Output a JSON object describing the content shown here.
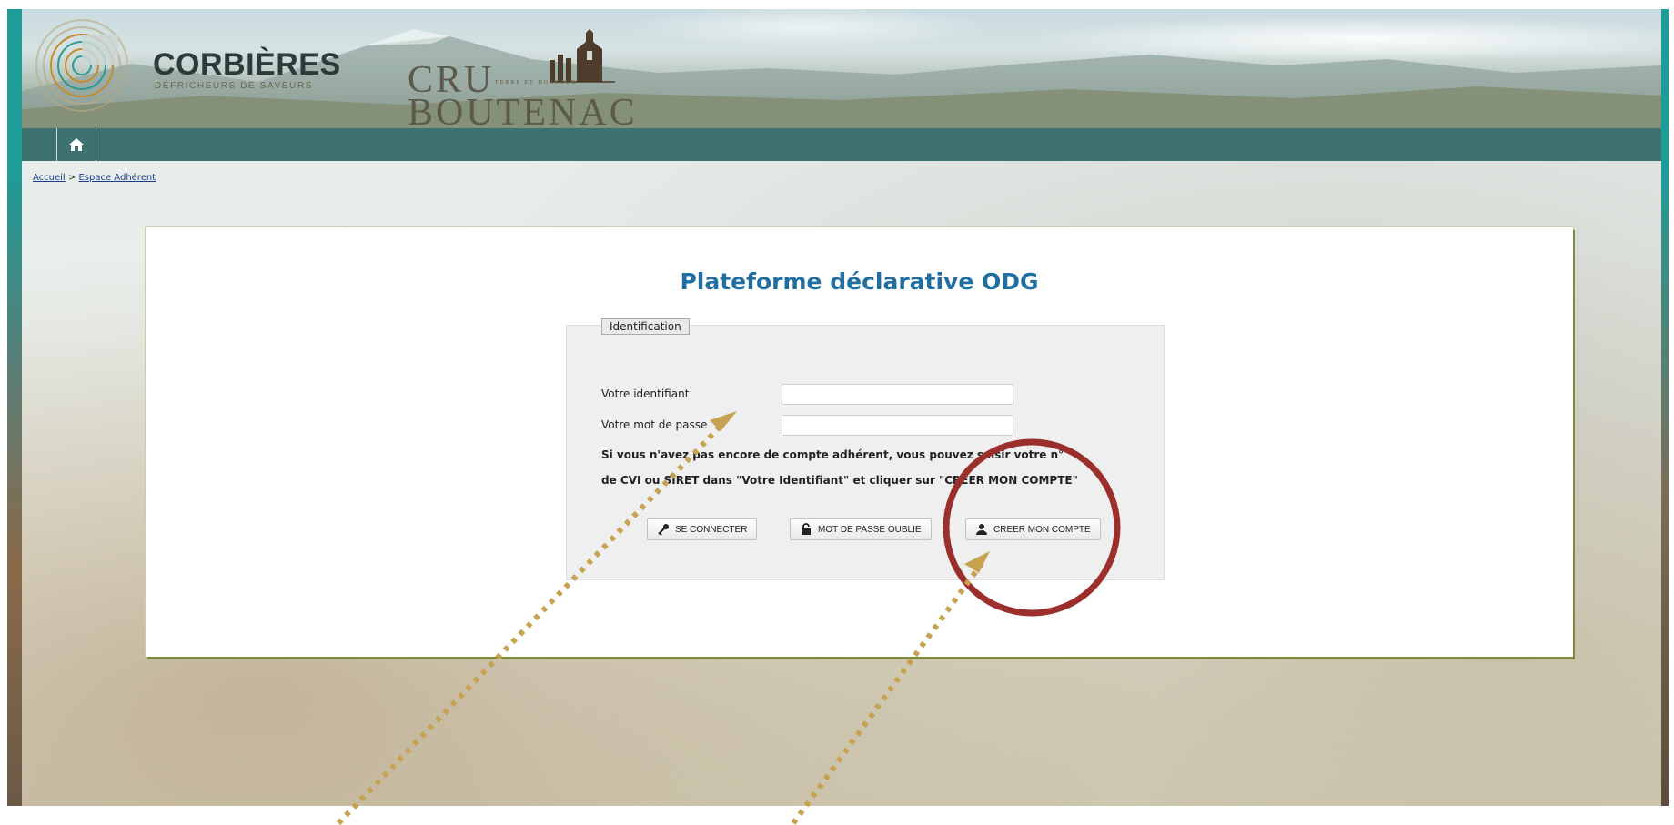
{
  "banner": {
    "brand_name": "CORBIÈRES",
    "brand_tagline": "DÉFRICHEURS DE SAVEURS",
    "cru": "CRU",
    "cru_tagline": "TERRE ET DOUCEUR",
    "boutenac": "BOUTENAC"
  },
  "nav": {
    "home_icon": "home-icon"
  },
  "breadcrumb": {
    "home": "Accueil",
    "separator": " > ",
    "current": "Espace Adhérent"
  },
  "main": {
    "title": "Plateforme déclarative ODG",
    "legend": "Identification",
    "identifiant_label": "Votre identifiant",
    "identifiant_value": "",
    "password_label": "Votre mot de passe",
    "password_value": "",
    "help_line1": "Si vous n'avez pas encore de compte adhérent, vous pouvez saisir votre n°",
    "help_line2": "de CVI ou SIRET dans \"Votre Identifiant\" et cliquer sur \"CREER MON COMPTE\""
  },
  "buttons": {
    "connect": {
      "label": "SE CONNECTER",
      "icon": "key-icon"
    },
    "forgot": {
      "label": "MOT DE PASSE OUBLIE",
      "icon": "unlock-icon"
    },
    "create": {
      "label": "CREER MON COMPTE",
      "icon": "user-icon"
    }
  },
  "colors": {
    "nav_bar": "#3d7271",
    "title": "#1f6fa3",
    "annotation_circle": "#9a2f2c",
    "annotation_arrow": "#c6a251"
  }
}
